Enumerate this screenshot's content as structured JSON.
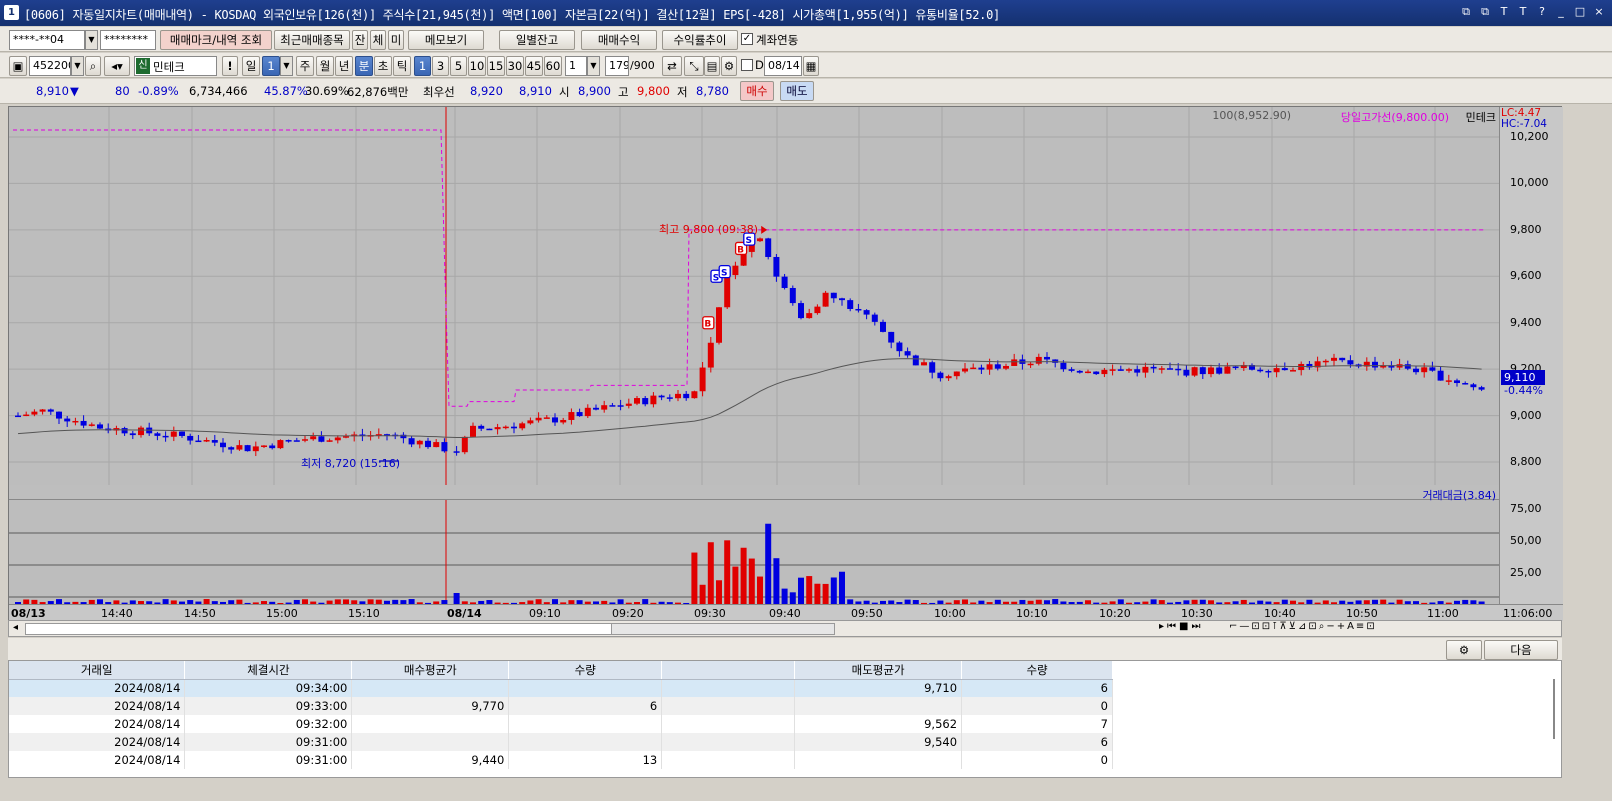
{
  "titlebar": {
    "icon": "1",
    "title": "[0606] 자동일지차트(매매내역) - KOSDAQ 외국인보유[126(천)] 주식수[21,945(천)] 액면[100] 자본금[22(억)] 결산[12월] EPS[-428] 시가총액[1,955(억)] 유통비율[52.0]",
    "controls": [
      "⧉",
      "⧉",
      "T",
      "T",
      "?",
      "_",
      "□",
      "×"
    ]
  },
  "account_row": {
    "account": "****-**04",
    "password": "********",
    "buttons": [
      "매매마크/내역 조회",
      "최근매매종목",
      "잔",
      "체",
      "미",
      "메모보기",
      "일별잔고",
      "매매수익",
      "수익률추이"
    ],
    "checkbox_label": "계좌연동",
    "checkbox_checked": true
  },
  "chart_toolbar": {
    "code": "452200",
    "badge": "신",
    "name": "민테크",
    "exclaim": "!",
    "periods": [
      "일",
      "1",
      "주",
      "월",
      "년",
      "분",
      "초",
      "틱"
    ],
    "minute_options": [
      "1",
      "3",
      "5",
      "10",
      "15",
      "30",
      "45",
      "60"
    ],
    "selected_minute": "1",
    "unit": "1",
    "count": "179",
    "count_total": "/900",
    "date_label": "D",
    "date": "08/14"
  },
  "quote": {
    "price": "8,910",
    "direction": "▼",
    "change": "80",
    "change_pct": "-0.89%",
    "volume": "6,734,466",
    "vol_ratio": "45.87%",
    "turnover": "30.69%",
    "amount": "62,876백만",
    "best_label": "최우선",
    "ask": "8,920",
    "bid": "8,910",
    "open_label": "시",
    "open": "8,900",
    "high_label": "고",
    "high": "9,800",
    "low_label": "저",
    "low": "8,780",
    "buy_btn": "매수",
    "sell_btn": "매도"
  },
  "legend": {
    "ma": "100(8,952.90)",
    "dayhigh": "당일고가선(9,800.00)",
    "name": "민테크",
    "lc": "LC:4.47",
    "hc": "HC:-7.04",
    "volume": "거래대금(3.84)"
  },
  "annotations": {
    "high": "최고 9,800 (09:38)",
    "low": "최저 8,720 (15:16)",
    "current": "9,110",
    "current_pct": "-0.44%"
  },
  "chart_data": {
    "type": "candlestick",
    "y_ticks": [
      "10,200",
      "10,000",
      "9,800",
      "9,600",
      "9,400",
      "9,200",
      "9,000",
      "8,800"
    ],
    "y_tick_values": [
      10200,
      10000,
      9800,
      9600,
      9400,
      9200,
      9000,
      8800
    ],
    "vol_ticks": [
      "75,00",
      "50,00",
      "25,00"
    ],
    "x_labels": [
      "08/13",
      "14:40",
      "14:50",
      "15:00",
      "15:10",
      "08/14",
      "09:10",
      "09:20",
      "09:30",
      "09:40",
      "09:50",
      "10:00",
      "10:10",
      "10:20",
      "10:30",
      "10:40",
      "10:50",
      "11:00",
      "11:06:00"
    ],
    "high": 9800,
    "low": 8720,
    "prev_day_high": 10230,
    "ma100_last": 8952.9,
    "last_close": 9110,
    "colors": {
      "up": "#e00000",
      "down": "#0000e0",
      "ma": "#555555",
      "dayhigh": "#e000e0"
    },
    "trade_marks": [
      "B",
      "B",
      "S",
      "S",
      "S"
    ]
  },
  "trades": {
    "headers": [
      "거래일",
      "체결시간",
      "매수평균가",
      "수량",
      "",
      "매도평균가",
      "수량"
    ],
    "rows": [
      [
        "2024/08/14",
        "09:34:00",
        "",
        "",
        "",
        "9,710",
        "6"
      ],
      [
        "2024/08/14",
        "09:33:00",
        "9,770",
        "6",
        "",
        "",
        "0"
      ],
      [
        "2024/08/14",
        "09:32:00",
        "",
        "",
        "",
        "9,562",
        "7"
      ],
      [
        "2024/08/14",
        "09:31:00",
        "",
        "",
        "",
        "9,540",
        "6"
      ],
      [
        "2024/08/14",
        "09:31:00",
        "9,440",
        "13",
        "",
        "",
        "0"
      ]
    ],
    "next_btn": "다음"
  }
}
